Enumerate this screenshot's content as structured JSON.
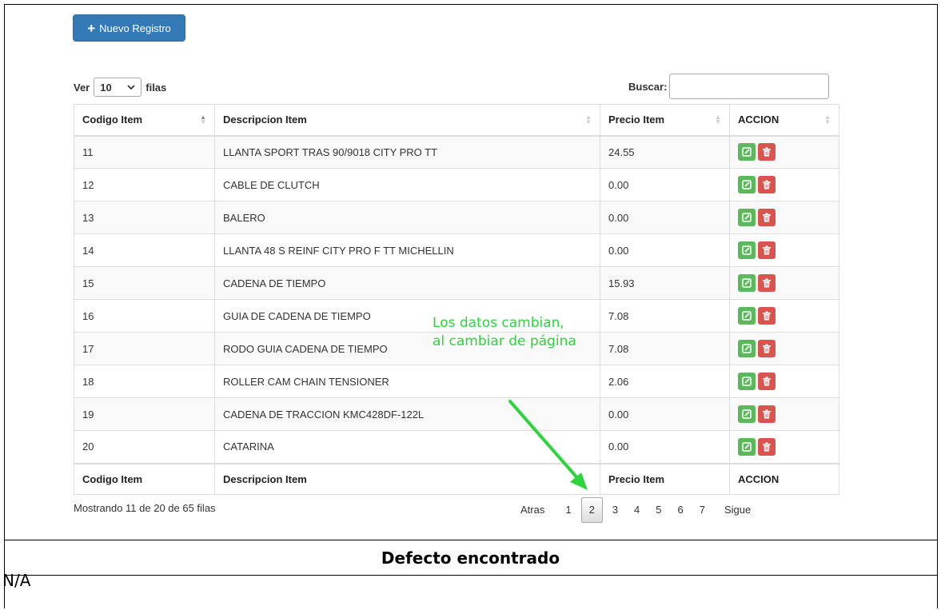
{
  "toolbar": {
    "new_label": "Nuevo Registro"
  },
  "length": {
    "prefix": "Ver",
    "value": "10",
    "suffix": "filas"
  },
  "filter": {
    "label": "Buscar:",
    "value": ""
  },
  "table": {
    "headers": [
      "Codigo Item",
      "Descripcion Item",
      "Precio Item",
      "ACCION"
    ],
    "rows": [
      [
        "11",
        "LLANTA SPORT TRAS 90/9018 CITY PRO TT",
        "24.55"
      ],
      [
        "12",
        "CABLE DE CLUTCH",
        "0.00"
      ],
      [
        "13",
        "BALERO",
        "0.00"
      ],
      [
        "14",
        "LLANTA 48 S REINF CITY PRO F TT MICHELLIN",
        "0.00"
      ],
      [
        "15",
        "CADENA DE TIEMPO",
        "15.93"
      ],
      [
        "16",
        "GUIA DE CADENA DE TIEMPO",
        "7.08"
      ],
      [
        "17",
        "RODO GUIA CADENA DE TIEMPO",
        "7.08"
      ],
      [
        "18",
        "ROLLER CAM CHAIN TENSIONER",
        "2.06"
      ],
      [
        "19",
        "CADENA DE TRACCION KMC428DF-122L",
        "0.00"
      ],
      [
        "20",
        "CATARINA",
        "0.00"
      ]
    ]
  },
  "info": "Mostrando 11 de 20 de 65 filas",
  "pagination": {
    "prev": "Atras",
    "pages": [
      "1",
      "2",
      "3",
      "4",
      "5",
      "6",
      "7"
    ],
    "current": "2",
    "next": "Sigue"
  },
  "annotation": {
    "line1": "Los datos cambian,",
    "line2": "al cambiar de página",
    "color": "#2ed43d"
  },
  "defect": {
    "title": "Defecto encontrado",
    "value": "N/A"
  },
  "colors": {
    "primary": "#337ab7",
    "edit": "#5cb85c",
    "delete": "#d9534f"
  }
}
